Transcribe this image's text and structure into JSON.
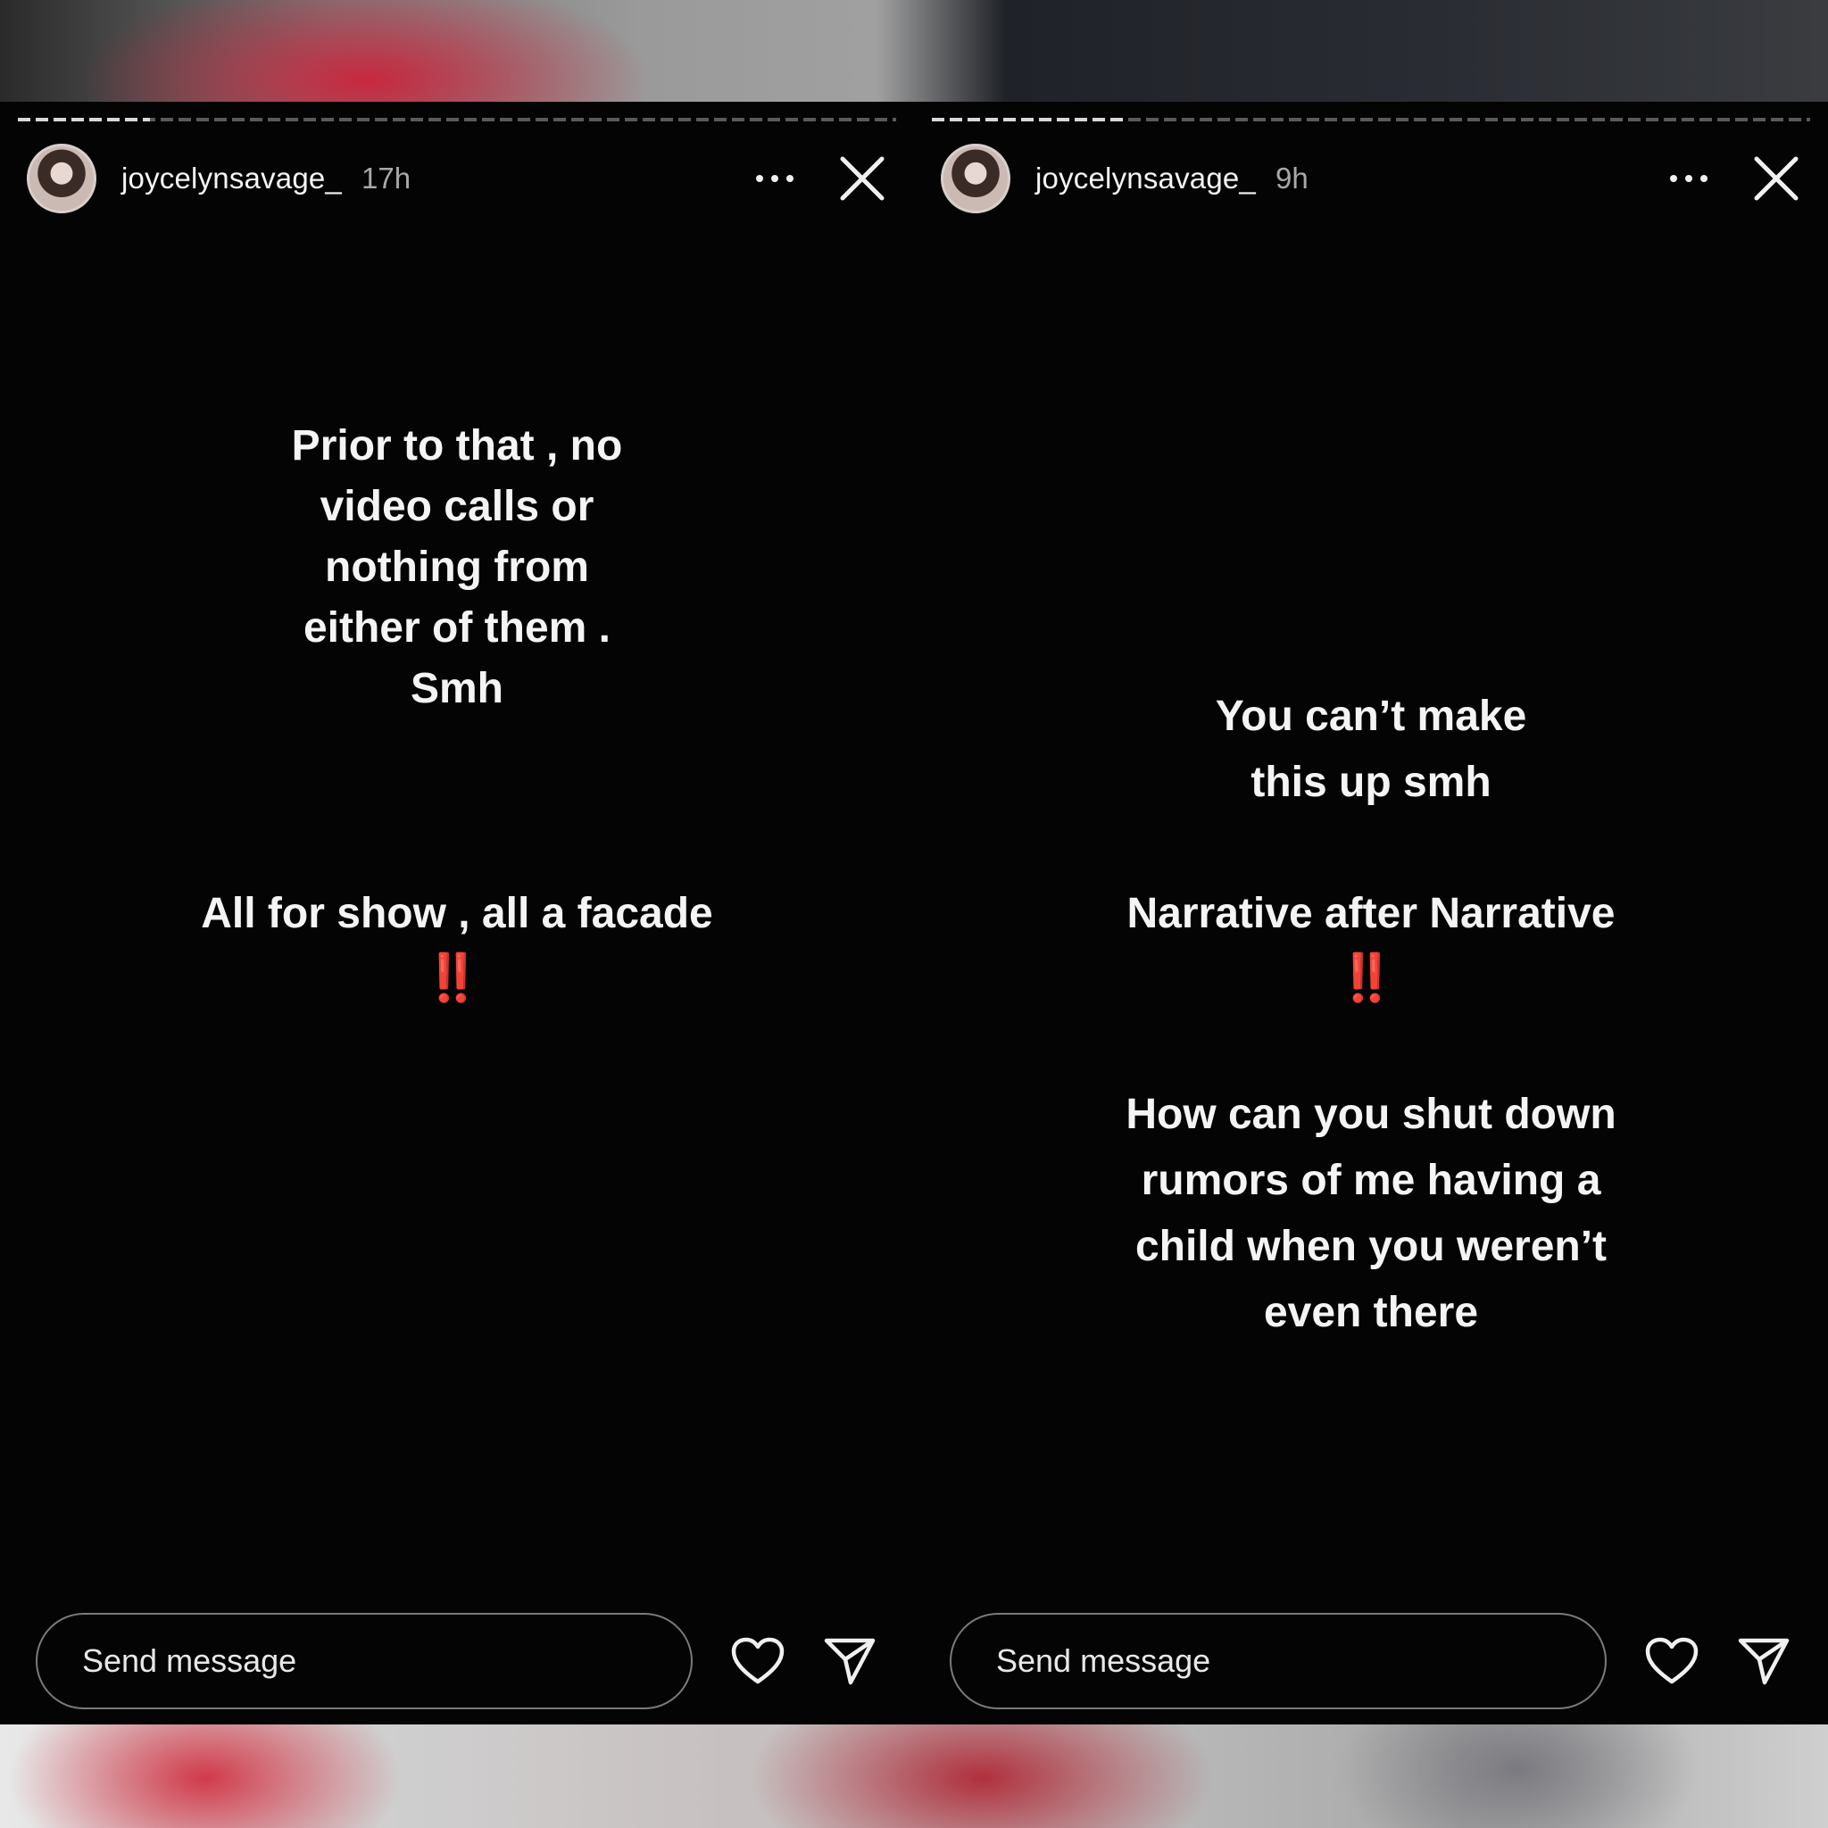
{
  "stories": [
    {
      "username": "joycelynsavage_",
      "time": "17h",
      "progress_fraction": 0.15,
      "text_blocks": [
        "Prior to that , no video calls or nothing from either of them . Smh",
        "All for show , all a facade"
      ],
      "emphasis": "‼️",
      "message_placeholder": "Send message"
    },
    {
      "username": "joycelynsavage_",
      "time": "9h",
      "progress_fraction": 0.22,
      "text_blocks": [
        "You can’t make this up smh",
        "Narrative after Narrative",
        "How can you shut down rumors of me having a child when you weren’t even there"
      ],
      "emphasis": "‼️",
      "message_placeholder": "Send message"
    }
  ],
  "icons": {
    "more": "more-horizontal-icon",
    "close": "close-icon",
    "like": "heart-icon",
    "share": "send-icon"
  },
  "colors": {
    "background": "#040404",
    "text": "#f4f4f4",
    "emphasis": "#e01818"
  }
}
